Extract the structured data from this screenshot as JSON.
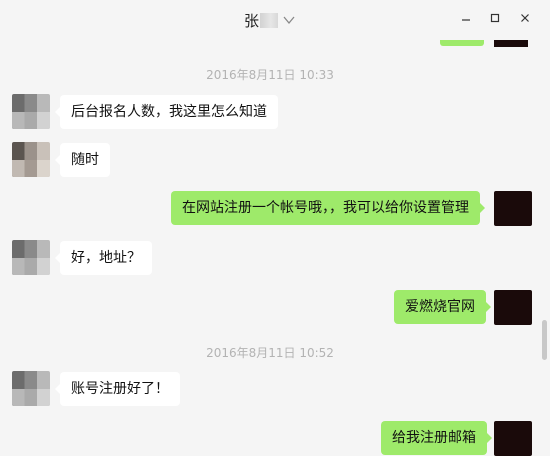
{
  "window": {
    "title": "张"
  },
  "icons": {
    "chevron": "chevron-down-icon",
    "minimize": "minimize-icon",
    "maximize": "maximize-icon",
    "close": "close-icon"
  },
  "colors": {
    "background": "#f5f5f5",
    "incoming_bubble": "#ffffff",
    "outgoing_bubble": "#9eea6a",
    "timestamp": "#b3b3b3"
  },
  "messages": {
    "ts1": "2016年8月11日 10:33",
    "m1": "后台报名人数，我这里怎么知道",
    "m2": "随时",
    "m3": "在网站注册一个帐号哦，，我可以给你设置管理",
    "m4": "好，地址？",
    "m5": "爱燃烧官网",
    "ts2": "2016年8月11日 10:52",
    "m6": "账号注册好了！",
    "m7": "给我注册邮箱"
  }
}
